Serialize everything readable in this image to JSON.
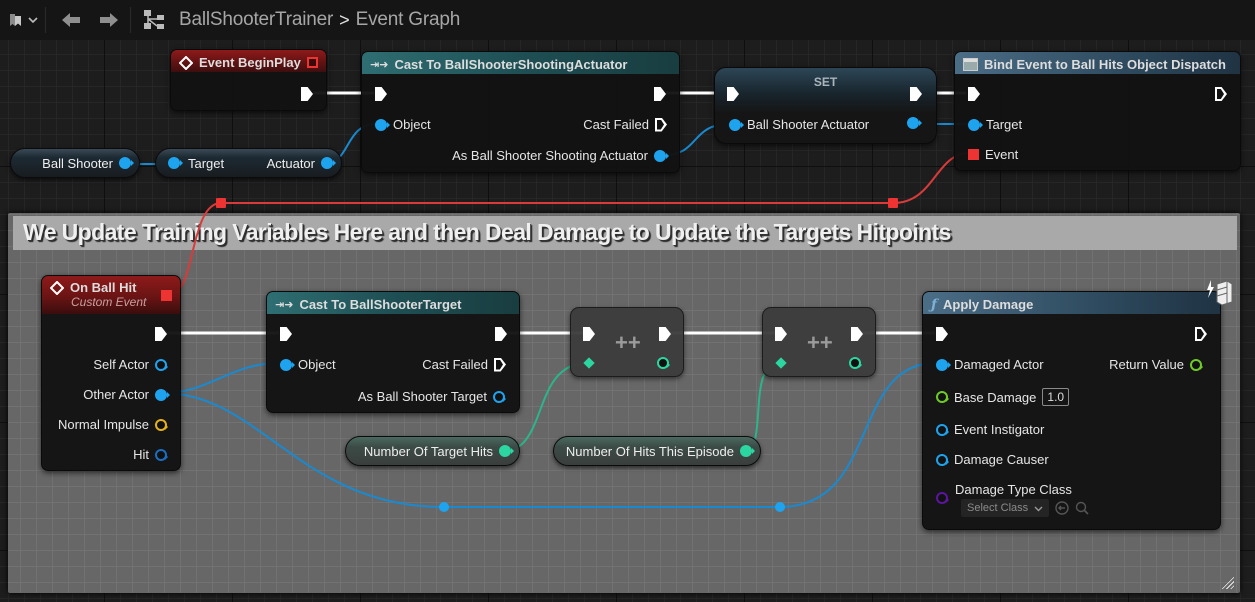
{
  "toolbar": {
    "bookmark_icon": "bookmark-icon",
    "back_icon": "arrow-left-icon",
    "forward_icon": "arrow-right-icon",
    "graph_icon": "blueprint-graph-icon",
    "breadcrumb": [
      "BallShooterTrainer",
      "Event Graph"
    ],
    "breadcrumb_separator": ">"
  },
  "comment": {
    "title": "We Update Training Variables Here and then Deal Damage to Update the Targets Hitpoints"
  },
  "nodes": {
    "begin_play": {
      "title": "Event BeginPlay",
      "icon": "event-icon"
    },
    "cast_actuator": {
      "title": "Cast To BallShooterShootingActuator",
      "pins": {
        "object": "Object",
        "cast_failed": "Cast Failed",
        "as_output": "As Ball Shooter Shooting Actuator"
      }
    },
    "set": {
      "title": "SET",
      "pins": {
        "input": "Ball Shooter Actuator"
      }
    },
    "bind_event": {
      "title": "Bind Event to Ball Hits Object Dispatch",
      "pins": {
        "target": "Target",
        "event": "Event"
      }
    },
    "ball_shooter_var": {
      "label": "Ball Shooter"
    },
    "get_actuator": {
      "target": "Target",
      "output": "Actuator"
    },
    "on_ball_hit": {
      "title": "On Ball Hit",
      "subtitle": "Custom Event",
      "pins": [
        "Self Actor",
        "Other Actor",
        "Normal Impulse",
        "Hit"
      ]
    },
    "cast_target": {
      "title": "Cast To BallShooterTarget",
      "pins": {
        "object": "Object",
        "cast_failed": "Cast Failed",
        "as_output": "As Ball Shooter Target"
      }
    },
    "increment_1": {
      "op": "++"
    },
    "increment_2": {
      "op": "++"
    },
    "num_target_hits": {
      "label": "Number Of Target Hits"
    },
    "num_hits_episode": {
      "label": "Number Of Hits This Episode"
    },
    "apply_damage": {
      "title": "Apply Damage",
      "icon": "function-icon",
      "pins": {
        "damaged_actor": "Damaged Actor",
        "return_value": "Return Value",
        "base_damage": "Base Damage",
        "base_damage_value": "1.0",
        "event_instigator": "Event Instigator",
        "damage_causer": "Damage Causer",
        "damage_type_class": "Damage Type Class",
        "select_class": "Select Class"
      }
    }
  },
  "colors": {
    "object_pin": "#1ea3ef",
    "int_pin": "#2bd6a0",
    "float_pin": "#6ecb25",
    "vector_pin": "#e6b219",
    "struct_pin": "#1b6fc2",
    "class_pin": "#5d149e",
    "delegate_pin": "#ee3333",
    "exec_wire": "#ffffff"
  }
}
